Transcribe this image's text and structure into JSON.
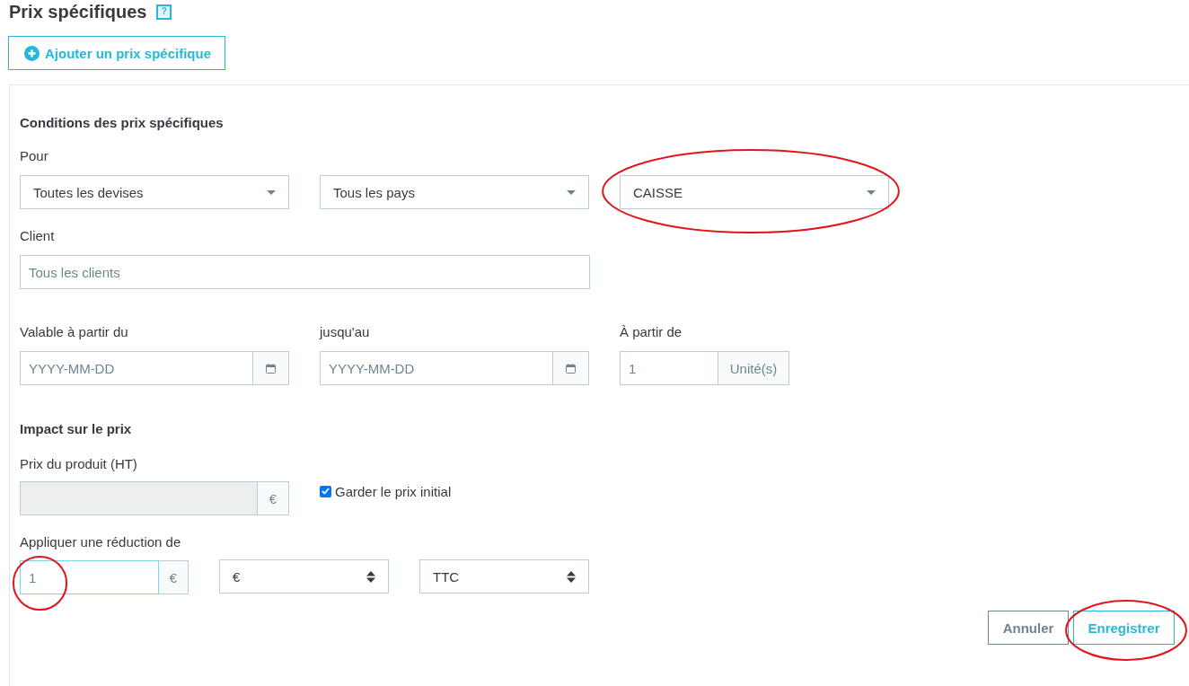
{
  "title": "Prix spécifiques",
  "help": "?",
  "add_button": "Ajouter un prix spécifique",
  "conditions": {
    "heading": "Conditions des prix spécifiques",
    "for_label": "Pour",
    "selects": [
      {
        "value": "Toutes les devises",
        "circled": false
      },
      {
        "value": "Tous les pays",
        "circled": false
      },
      {
        "value": "CAISSE",
        "circled": true
      }
    ],
    "client_label": "Client",
    "client_field": {
      "placeholder": "Tous les clients"
    },
    "from_label": "Valable à partir du",
    "from_field": {
      "placeholder": "YYYY-MM-DD"
    },
    "to_label": "jusqu'au",
    "to_field": {
      "placeholder": "YYYY-MM-DD"
    },
    "quantity_label": "À partir de",
    "quantity_field": {
      "value": "1",
      "unit": "Unité(s)"
    }
  },
  "impact": {
    "heading": "Impact sur le prix",
    "price_label": "Prix du produit (HT)",
    "price_field": {
      "disabled": true,
      "unit": "€"
    },
    "keep_initial": {
      "label": "Garder le prix initial",
      "checked": true
    },
    "reduction_label": "Appliquer une réduction de",
    "reduction_field": {
      "value": "1",
      "unit": "€",
      "focused": true,
      "circled": true
    },
    "reduction_type": {
      "value": "€"
    },
    "tax": {
      "value": "TTC"
    }
  },
  "buttons": [
    {
      "label": "Annuler",
      "kind": "cancel",
      "circled": false
    },
    {
      "label": "Enregistrer",
      "kind": "save",
      "circled": true
    }
  ]
}
